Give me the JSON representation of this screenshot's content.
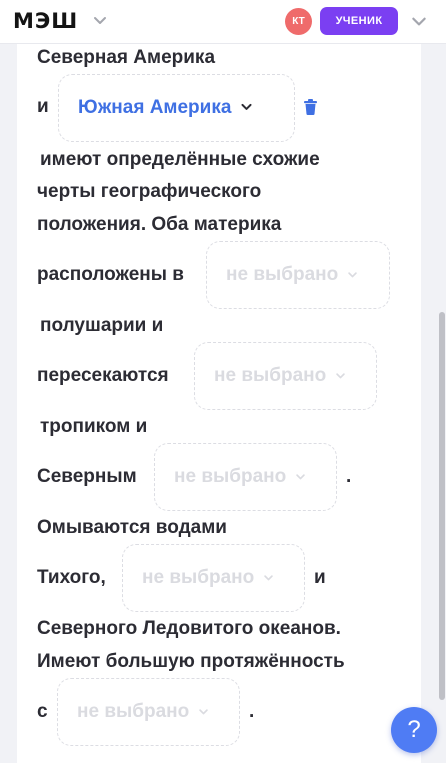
{
  "header": {
    "logo": "МЭШ",
    "avatar_initials": "КТ",
    "role_badge": "УЧЕНИК"
  },
  "exercise": {
    "t1": "Северная Америка",
    "t2": "и",
    "selected_option": "Южная Америка",
    "t3": "имеют определённые схожие",
    "t4": "черты географического",
    "t5": "положения. Оба материка",
    "t6": "расположены в",
    "t7": "полушарии и",
    "t8": "пересекаются",
    "t9": "тропиком и",
    "t10": "Северным",
    "t11": ".",
    "t12": "Омываются водами",
    "t13": "Тихого,",
    "t14": "и",
    "t15": "Северного Ледовитого океанов.",
    "t16": "Имеют большую протяжённость",
    "t17": "с",
    "t18": ".",
    "placeholder": "не выбрано"
  },
  "help": {
    "label": "?"
  },
  "colors": {
    "accent_purple": "#7b3ff2",
    "selected_blue": "#3f70e3",
    "help_blue": "#4f7cf4",
    "avatar_red": "#ef6b6b"
  }
}
